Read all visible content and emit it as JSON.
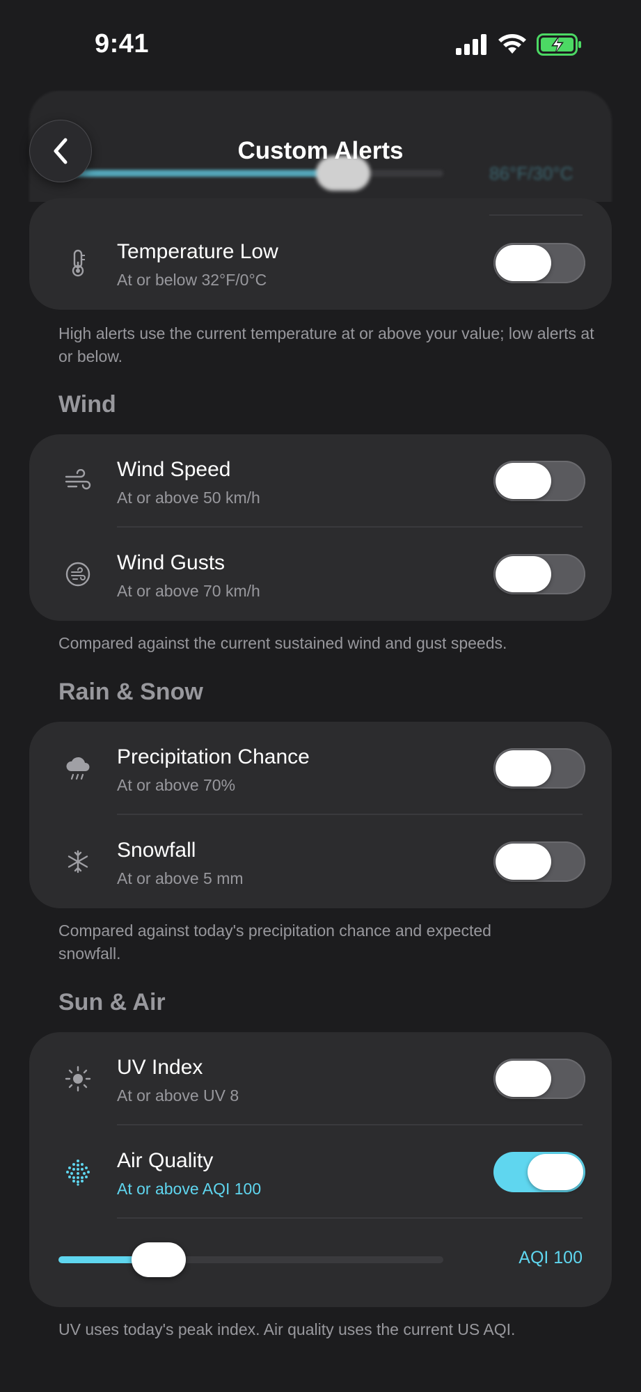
{
  "status_bar": {
    "time": "9:41"
  },
  "header": {
    "title": "Custom Alerts"
  },
  "scrolled_behind": {
    "slider_value": "86°F/30°C"
  },
  "temperature": {
    "rows": [
      {
        "title": "Temperature Low",
        "subtitle": "At or below 32°F/0°C",
        "icon": "thermometer-icon",
        "enabled": false
      }
    ],
    "footnote": "High alerts use the current temperature at or above your value; low alerts at or below."
  },
  "wind": {
    "header": "Wind",
    "rows": [
      {
        "title": "Wind Speed",
        "subtitle": "At or above 50 km/h",
        "icon": "wind-icon",
        "enabled": false
      },
      {
        "title": "Wind Gusts",
        "subtitle": "At or above 70 km/h",
        "icon": "wind-gust-icon",
        "enabled": false
      }
    ],
    "footnote": "Compared against the current sustained wind and gust speeds."
  },
  "rain_snow": {
    "header": "Rain & Snow",
    "rows": [
      {
        "title": "Precipitation Chance",
        "subtitle": "At or above 70%",
        "icon": "cloud-rain-icon",
        "enabled": false
      },
      {
        "title": "Snowfall",
        "subtitle": "At or above 5 mm",
        "icon": "snowflake-icon",
        "enabled": false
      }
    ],
    "footnote": "Compared against today's precipitation chance and expected snowfall."
  },
  "sun_air": {
    "header": "Sun & Air",
    "rows": [
      {
        "title": "UV Index",
        "subtitle": "At or above UV 8",
        "icon": "sun-icon",
        "enabled": false
      },
      {
        "title": "Air Quality",
        "subtitle": "At or above AQI 100",
        "icon": "air-quality-icon",
        "enabled": true
      }
    ],
    "aqi_slider": {
      "value_label": "AQI 100",
      "fraction": 0.19
    },
    "footnote": "UV uses today's peak index. Air quality uses the current US AQI."
  },
  "colors": {
    "accent": "#5fd6ef",
    "background": "#1c1c1e",
    "card": "#2c2c2e",
    "secondary_text": "#98989d",
    "battery": "#4cd964"
  }
}
